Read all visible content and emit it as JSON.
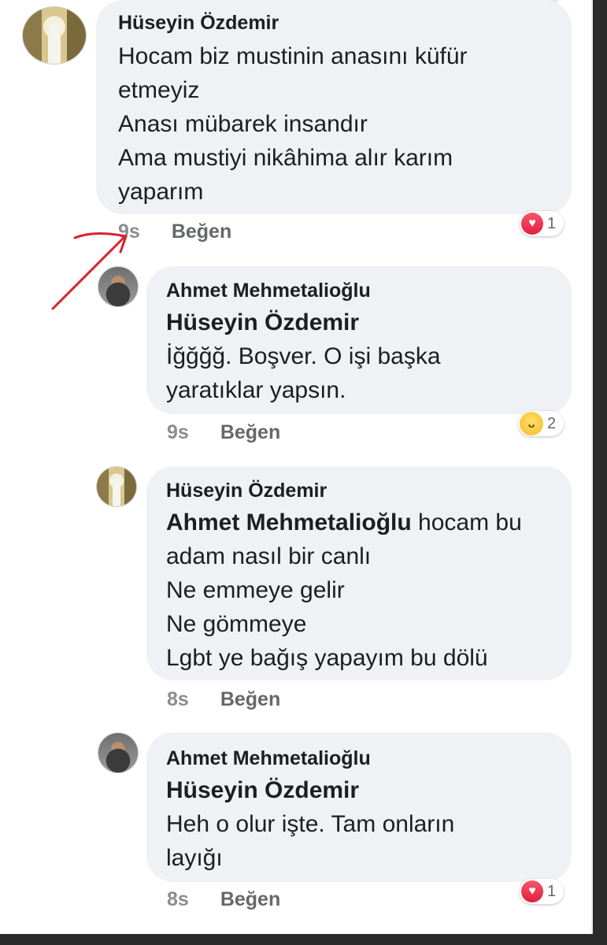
{
  "comments": [
    {
      "author": "Hüseyin Özdemir",
      "mention": "",
      "lines": [
        "Hocam biz mustinin anasını küfür",
        "etmeyiz",
        "Anası mübarek insandır",
        "Ama mustiyi nikâhima alır karım",
        "yaparım"
      ],
      "time": "9s",
      "like_label": "Beğen",
      "reaction": {
        "type": "heart-icon",
        "count": "1"
      }
    },
    {
      "author": "Ahmet Mehmetalioğlu",
      "mention": "Hüseyin Özdemir",
      "lines": [
        "İğğğğ. Boşver. O işi başka",
        "yaratıklar yapsın."
      ],
      "time": "9s",
      "like_label": "Beğen",
      "reaction": {
        "type": "haha-icon",
        "count": "2"
      }
    },
    {
      "author": "Hüseyin Özdemir",
      "mention": "Ahmet Mehmetalioğlu",
      "mention_tail": " hocam bu",
      "lines": [
        "adam nasıl bir canlı",
        "Ne emmeye gelir",
        "Ne gömmeye",
        "Lgbt ye bağış yapayım bu dölü"
      ],
      "time": "8s",
      "like_label": "Beğen"
    },
    {
      "author": "Ahmet Mehmetalioğlu",
      "mention": "Hüseyin Özdemir",
      "lines": [
        "Heh o olur işte. Tam onların",
        "layığı"
      ],
      "time": "8s",
      "like_label": "Beğen",
      "reaction": {
        "type": "heart-icon",
        "count": "1"
      }
    }
  ],
  "colors": {
    "bubble": "#f0f1f4",
    "annotation_arrow": "#d9232e",
    "heart": "#e41e3f",
    "haha": "#f7b928"
  }
}
